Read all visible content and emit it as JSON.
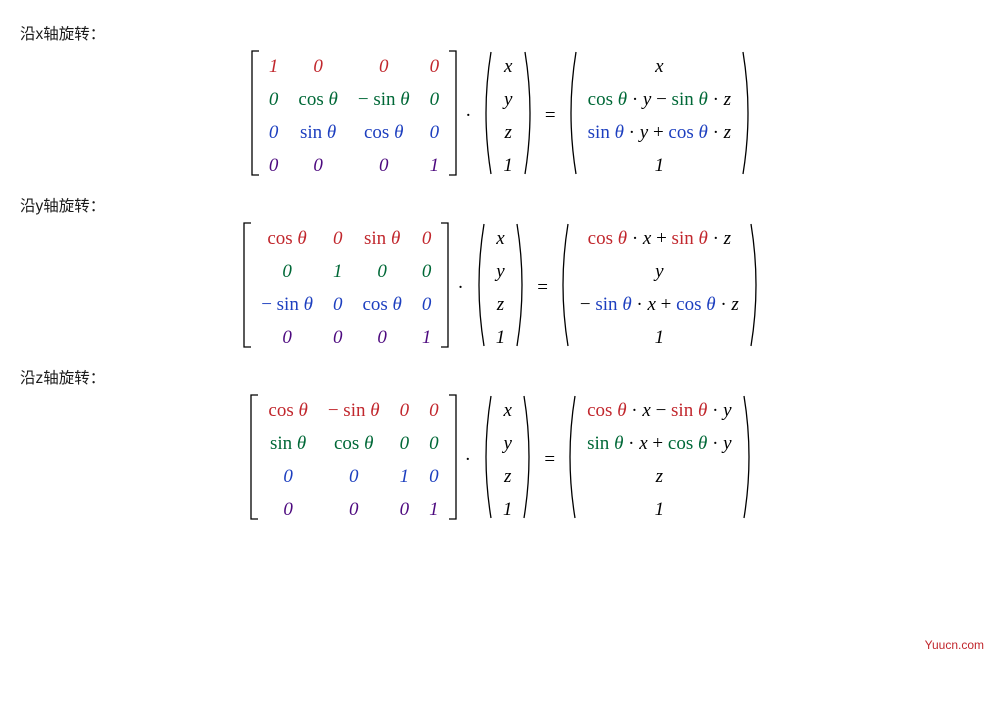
{
  "labels": {
    "x_axis": "沿x轴旋转：",
    "y_axis": "沿y轴旋转：",
    "z_axis": "沿z轴旋转："
  },
  "symbols": {
    "theta": "θ",
    "cos": "cos",
    "sin": "sin",
    "dot_op": "·",
    "eq_op": "=",
    "minus": "−",
    "plus": "+",
    "x": "x",
    "y": "y",
    "z": "z",
    "one": "1",
    "zero": "0"
  },
  "colors": {
    "red": "#c1272d",
    "green": "#006837",
    "blue": "#1d3fbf",
    "purple": "#4d0a7f",
    "black": "#000000"
  },
  "equations": {
    "x": {
      "matrix": [
        [
          {
            "t": "1",
            "c": "r"
          },
          {
            "t": "0",
            "c": "r"
          },
          {
            "t": "0",
            "c": "r"
          },
          {
            "t": "0",
            "c": "r"
          }
        ],
        [
          {
            "t": "0",
            "c": "g"
          },
          {
            "t": "cos θ",
            "c": "g"
          },
          {
            "t": "− sin θ",
            "c": "g"
          },
          {
            "t": "0",
            "c": "g"
          }
        ],
        [
          {
            "t": "0",
            "c": "b"
          },
          {
            "t": "sin θ",
            "c": "b"
          },
          {
            "t": "cos θ",
            "c": "b"
          },
          {
            "t": "0",
            "c": "b"
          }
        ],
        [
          {
            "t": "0",
            "c": "p"
          },
          {
            "t": "0",
            "c": "p"
          },
          {
            "t": "0",
            "c": "p"
          },
          {
            "t": "1",
            "c": "p"
          }
        ]
      ],
      "vector": [
        "x",
        "y",
        "z",
        "1"
      ],
      "result": [
        [
          {
            "t": "x",
            "c": "k"
          }
        ],
        [
          {
            "t": "cos θ",
            "c": "g"
          },
          {
            "t": " · ",
            "c": "k"
          },
          {
            "t": "y",
            "c": "k"
          },
          {
            "t": " − ",
            "c": "k"
          },
          {
            "t": "sin θ",
            "c": "g"
          },
          {
            "t": " · ",
            "c": "k"
          },
          {
            "t": "z",
            "c": "k"
          }
        ],
        [
          {
            "t": "sin θ",
            "c": "b"
          },
          {
            "t": " · ",
            "c": "k"
          },
          {
            "t": "y",
            "c": "k"
          },
          {
            "t": " + ",
            "c": "k"
          },
          {
            "t": "cos θ",
            "c": "b"
          },
          {
            "t": " · ",
            "c": "k"
          },
          {
            "t": "z",
            "c": "k"
          }
        ],
        [
          {
            "t": "1",
            "c": "k"
          }
        ]
      ]
    },
    "y": {
      "matrix": [
        [
          {
            "t": "cos θ",
            "c": "r"
          },
          {
            "t": "0",
            "c": "r"
          },
          {
            "t": "sin θ",
            "c": "r"
          },
          {
            "t": "0",
            "c": "r"
          }
        ],
        [
          {
            "t": "0",
            "c": "g"
          },
          {
            "t": "1",
            "c": "g"
          },
          {
            "t": "0",
            "c": "g"
          },
          {
            "t": "0",
            "c": "g"
          }
        ],
        [
          {
            "t": "− sin θ",
            "c": "b"
          },
          {
            "t": "0",
            "c": "b"
          },
          {
            "t": "cos θ",
            "c": "b"
          },
          {
            "t": "0",
            "c": "b"
          }
        ],
        [
          {
            "t": "0",
            "c": "p"
          },
          {
            "t": "0",
            "c": "p"
          },
          {
            "t": "0",
            "c": "p"
          },
          {
            "t": "1",
            "c": "p"
          }
        ]
      ],
      "vector": [
        "x",
        "y",
        "z",
        "1"
      ],
      "result": [
        [
          {
            "t": "cos θ",
            "c": "r"
          },
          {
            "t": " · ",
            "c": "k"
          },
          {
            "t": "x",
            "c": "k"
          },
          {
            "t": " + ",
            "c": "k"
          },
          {
            "t": "sin θ",
            "c": "r"
          },
          {
            "t": " · ",
            "c": "k"
          },
          {
            "t": "z",
            "c": "k"
          }
        ],
        [
          {
            "t": "y",
            "c": "k"
          }
        ],
        [
          {
            "t": "− ",
            "c": "k"
          },
          {
            "t": "sin θ",
            "c": "b"
          },
          {
            "t": " · ",
            "c": "k"
          },
          {
            "t": "x",
            "c": "k"
          },
          {
            "t": " + ",
            "c": "k"
          },
          {
            "t": "cos θ",
            "c": "b"
          },
          {
            "t": " · ",
            "c": "k"
          },
          {
            "t": "z",
            "c": "k"
          }
        ],
        [
          {
            "t": "1",
            "c": "k"
          }
        ]
      ]
    },
    "z": {
      "matrix": [
        [
          {
            "t": "cos θ",
            "c": "r"
          },
          {
            "t": "− sin θ",
            "c": "r"
          },
          {
            "t": "0",
            "c": "r"
          },
          {
            "t": "0",
            "c": "r"
          }
        ],
        [
          {
            "t": "sin θ",
            "c": "g"
          },
          {
            "t": "cos θ",
            "c": "g"
          },
          {
            "t": "0",
            "c": "g"
          },
          {
            "t": "0",
            "c": "g"
          }
        ],
        [
          {
            "t": "0",
            "c": "b"
          },
          {
            "t": "0",
            "c": "b"
          },
          {
            "t": "1",
            "c": "b"
          },
          {
            "t": "0",
            "c": "b"
          }
        ],
        [
          {
            "t": "0",
            "c": "p"
          },
          {
            "t": "0",
            "c": "p"
          },
          {
            "t": "0",
            "c": "p"
          },
          {
            "t": "1",
            "c": "p"
          }
        ]
      ],
      "vector": [
        "x",
        "y",
        "z",
        "1"
      ],
      "result": [
        [
          {
            "t": "cos θ",
            "c": "r"
          },
          {
            "t": " · ",
            "c": "k"
          },
          {
            "t": "x",
            "c": "k"
          },
          {
            "t": " − ",
            "c": "k"
          },
          {
            "t": "sin θ",
            "c": "r"
          },
          {
            "t": " · ",
            "c": "k"
          },
          {
            "t": "y",
            "c": "k"
          }
        ],
        [
          {
            "t": "sin θ",
            "c": "g"
          },
          {
            "t": " · ",
            "c": "k"
          },
          {
            "t": "x",
            "c": "k"
          },
          {
            "t": " + ",
            "c": "k"
          },
          {
            "t": "cos θ",
            "c": "g"
          },
          {
            "t": " · ",
            "c": "k"
          },
          {
            "t": "y",
            "c": "k"
          }
        ],
        [
          {
            "t": "z",
            "c": "k"
          }
        ],
        [
          {
            "t": "1",
            "c": "k"
          }
        ]
      ]
    }
  },
  "watermark": "Yuucn.com"
}
